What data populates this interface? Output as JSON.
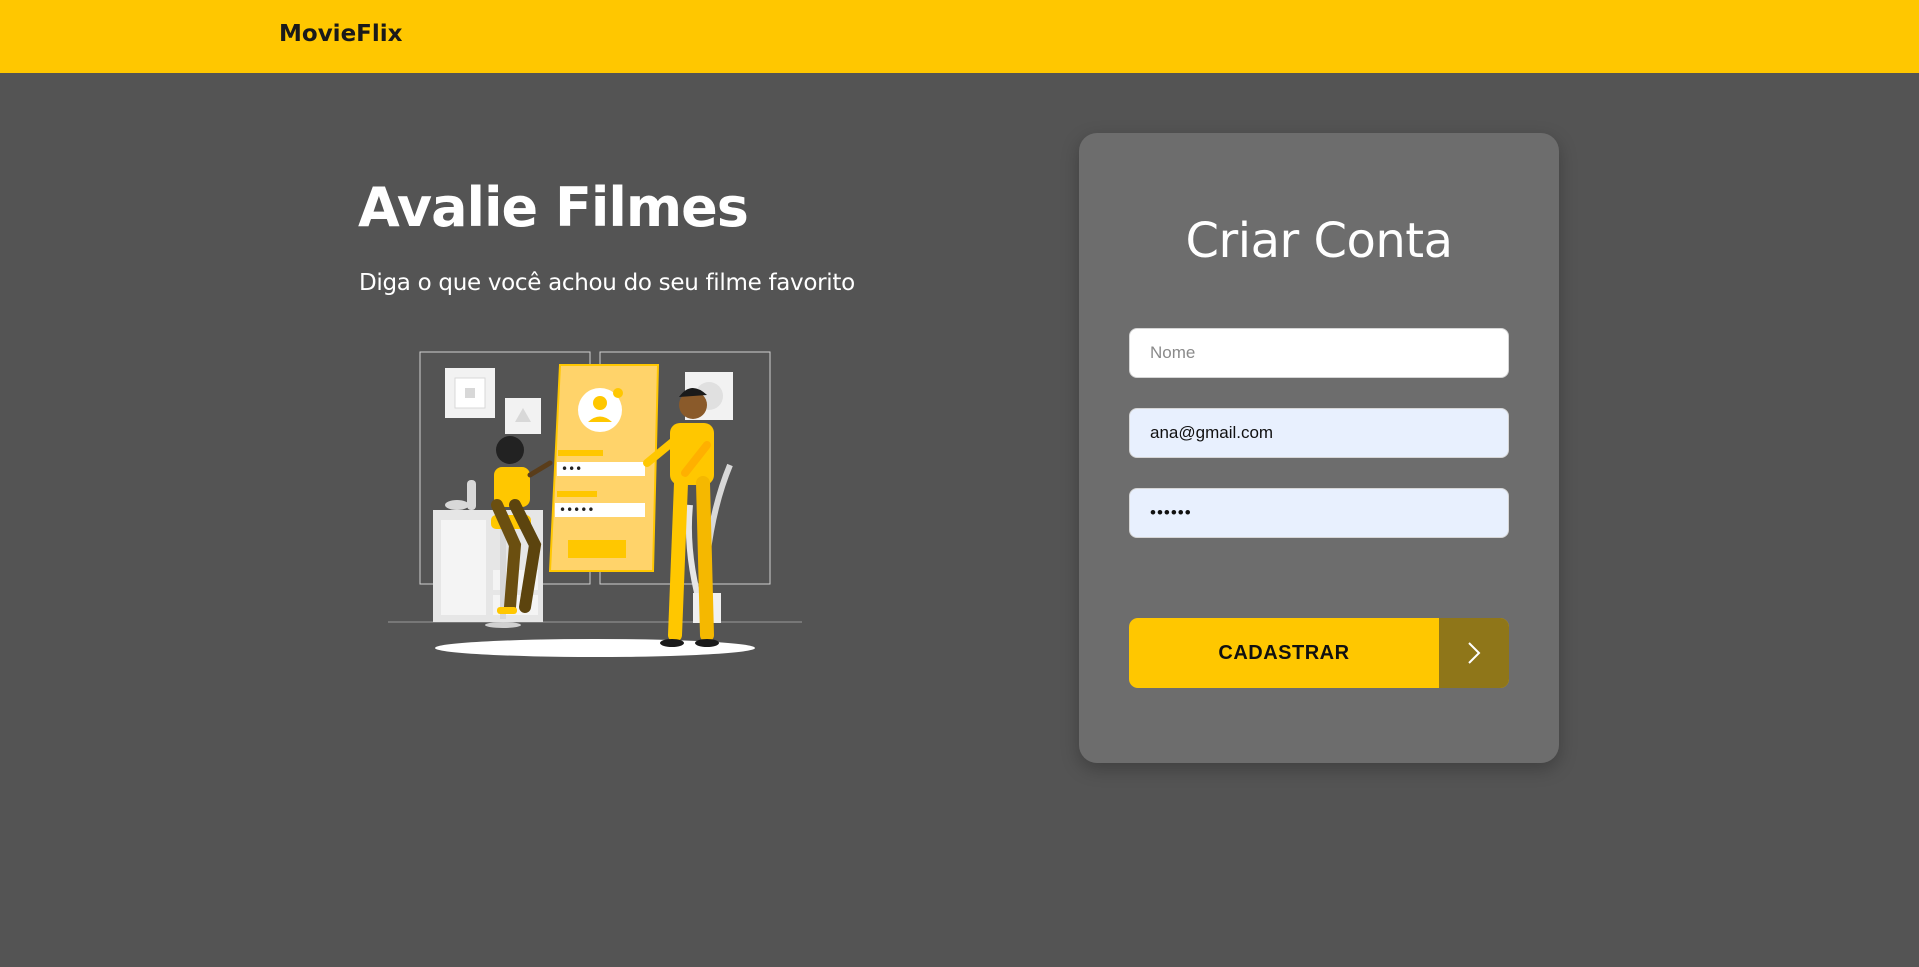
{
  "header": {
    "brand": "MovieFlix"
  },
  "hero": {
    "title": "Avalie Filmes",
    "subtitle": "Diga o que você achou do seu filme favorito"
  },
  "signup": {
    "title": "Criar Conta",
    "name_placeholder": "Nome",
    "name_value": "",
    "email_value": "ana@gmail.com",
    "password_value": "••••••",
    "submit_label": "CADASTRAR"
  },
  "colors": {
    "accent": "#ffc700",
    "background": "#545454",
    "card": "#6d6d6d",
    "arrow_block": "#8f7619"
  },
  "icons": {
    "submit_arrow": "chevron-right-icon"
  }
}
